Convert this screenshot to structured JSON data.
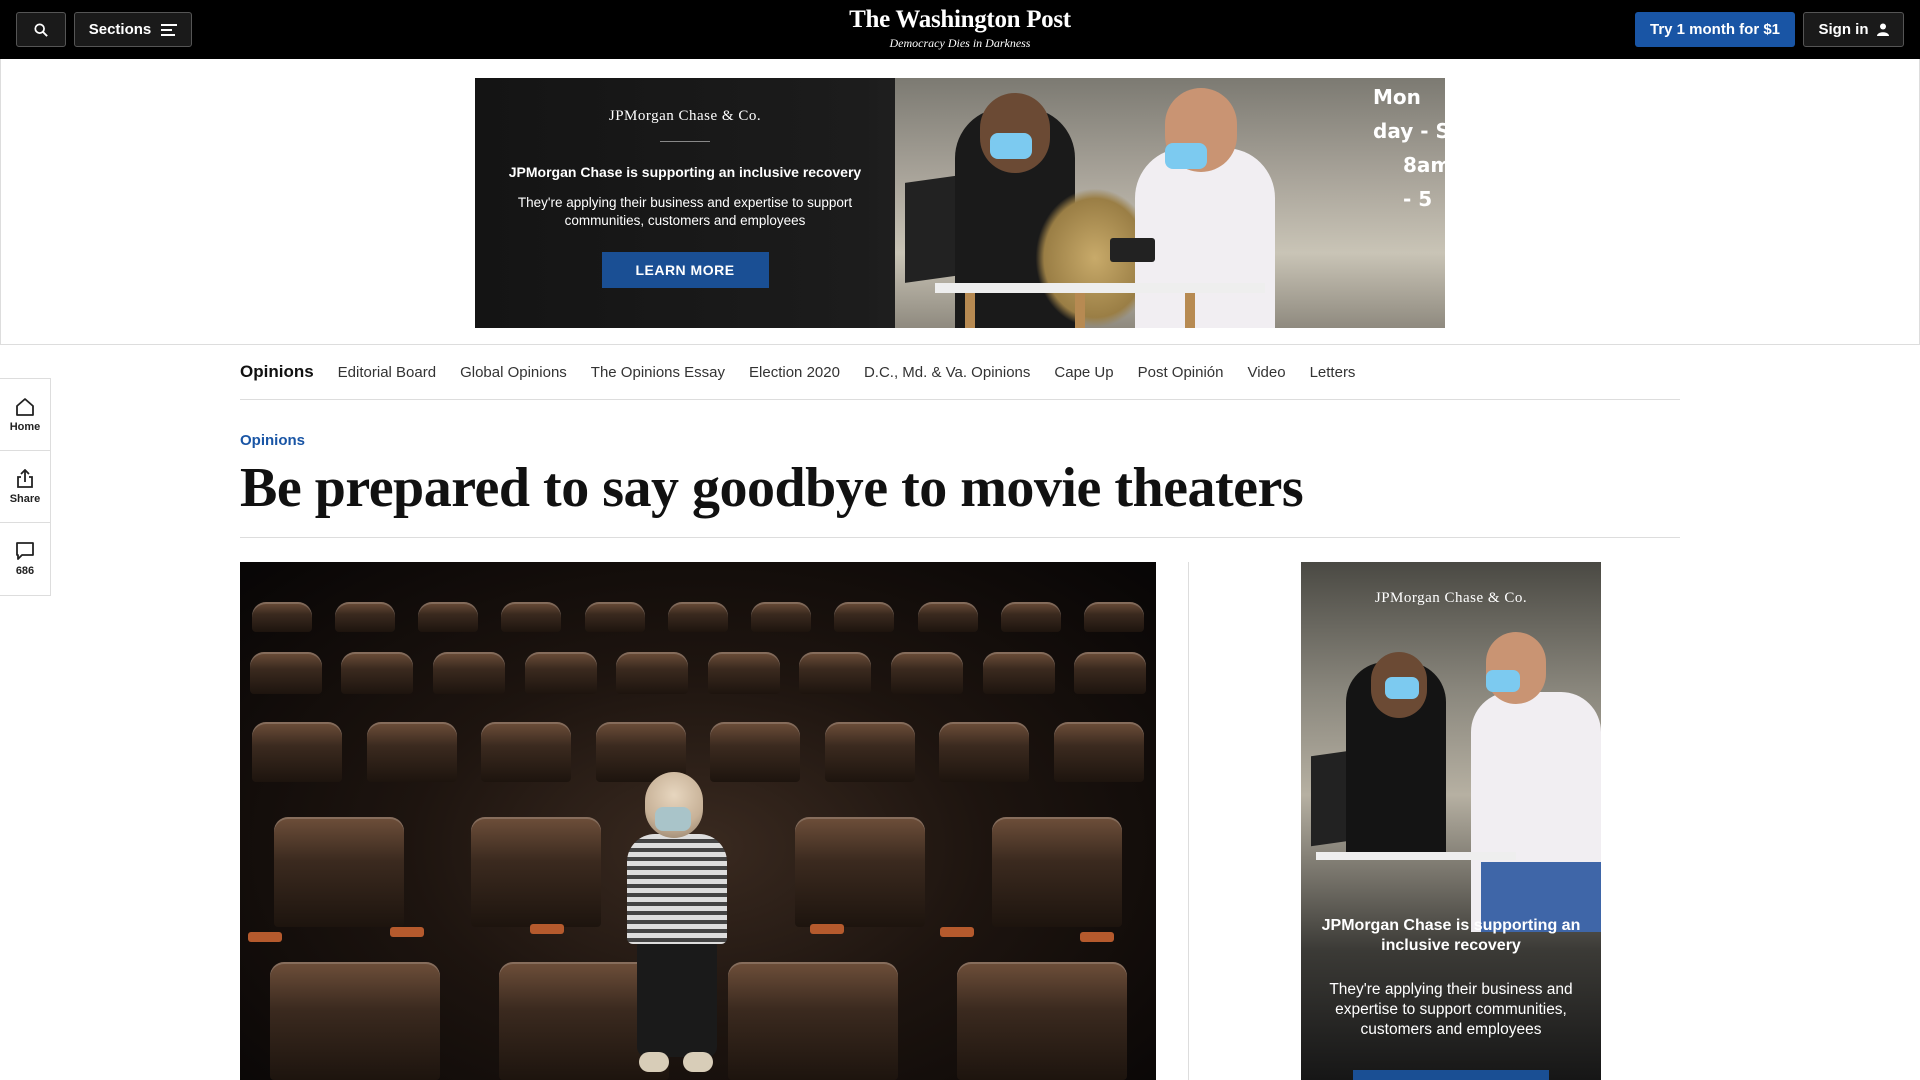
{
  "header": {
    "sections_label": "Sections",
    "logo_name": "The Washington Post",
    "logo_tagline": "Democracy Dies in Darkness",
    "trial_label": "Try 1 month for $1",
    "signin_label": "Sign in"
  },
  "top_ad": {
    "brand": "JPMorgan Chase & Co.",
    "headline": "JPMorgan Chase is supporting an inclusive recovery",
    "sub": "They're applying their business and expertise to support communities, customers and employees",
    "cta": "LEARN MORE",
    "sign_line1": "Mon day - S",
    "sign_line2": "8am - 5"
  },
  "rail": {
    "home_label": "Home",
    "share_label": "Share",
    "comments_count": "686"
  },
  "section_nav": [
    {
      "label": "Opinions",
      "active": true
    },
    {
      "label": "Editorial Board"
    },
    {
      "label": "Global Opinions"
    },
    {
      "label": "The Opinions Essay"
    },
    {
      "label": "Election 2020"
    },
    {
      "label": "D.C., Md. & Va. Opinions"
    },
    {
      "label": "Cape Up"
    },
    {
      "label": "Post Opinión"
    },
    {
      "label": "Video"
    },
    {
      "label": "Letters"
    }
  ],
  "article": {
    "kicker": "Opinions",
    "headline": "Be prepared to say goodbye to movie theaters"
  },
  "side_ad": {
    "brand": "JPMorgan Chase & Co.",
    "headline": "JPMorgan Chase is supporting an inclusive recovery",
    "sub": "They're applying their business and expertise to support communities, customers and employees"
  },
  "colors": {
    "accent_blue": "#1955a5",
    "topbar": "#000000"
  },
  "icons": [
    "search-icon",
    "menu-icon",
    "user-icon",
    "home-icon",
    "share-icon",
    "comment-icon"
  ]
}
